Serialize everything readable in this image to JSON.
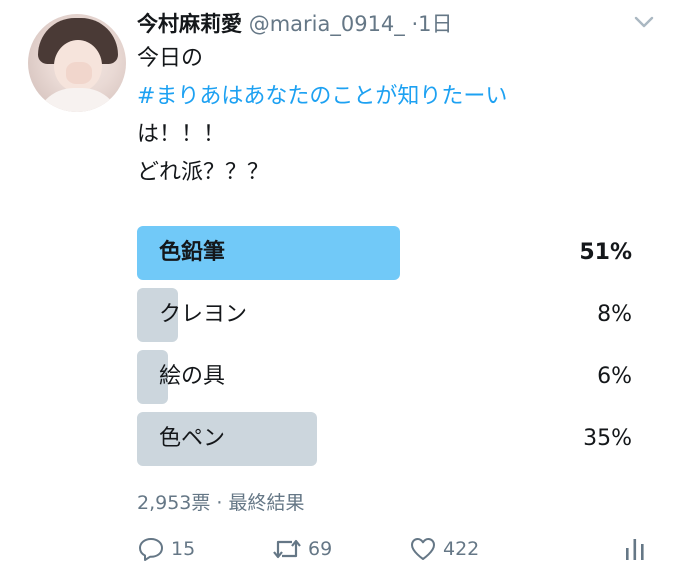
{
  "tweet": {
    "author": {
      "name": "今村麻莉愛",
      "handle": "@maria_0914_",
      "separator": "·",
      "time": "1日"
    },
    "text": {
      "line1": "今日の",
      "hashtag": "#まりあはあなたのことが知りたーい",
      "line3": "は！！！",
      "line4": "どれ派？？？"
    },
    "poll": {
      "options": [
        {
          "label": "色鉛筆",
          "percent_text": "51%",
          "percent": 51,
          "winner": true
        },
        {
          "label": "クレヨン",
          "percent_text": "8%",
          "percent": 8,
          "winner": false
        },
        {
          "label": "絵の具",
          "percent_text": "6%",
          "percent": 6,
          "winner": false
        },
        {
          "label": "色ペン",
          "percent_text": "35%",
          "percent": 35,
          "winner": false
        }
      ],
      "footer": "2,953票 · 最終結果"
    },
    "actions": {
      "replies": "15",
      "retweets": "69",
      "likes": "422"
    },
    "icons": {
      "menu": "chevron-down-icon",
      "reply": "reply-icon",
      "retweet": "retweet-icon",
      "like": "heart-icon",
      "analytics": "analytics-icon"
    },
    "colors": {
      "winner_bar": "#71c9f8",
      "other_bar": "#ccd6dd",
      "hashtag": "#1da1f2",
      "secondary_text": "#657786"
    }
  }
}
